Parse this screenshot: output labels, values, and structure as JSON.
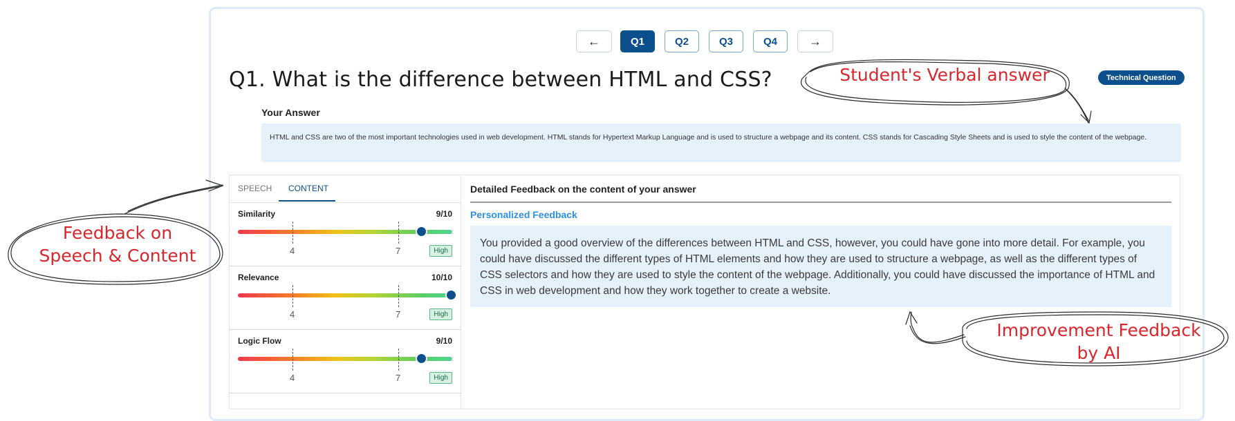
{
  "nav": {
    "prev_icon": "arrow-left-icon",
    "next_icon": "arrow-right-icon",
    "questions": [
      "Q1",
      "Q2",
      "Q3",
      "Q4"
    ],
    "active_question": "Q1"
  },
  "question": {
    "title": "Q1. What is the difference between HTML and CSS?",
    "tag": "Technical Question"
  },
  "answer": {
    "label": "Your Answer",
    "text": "HTML and CSS are two of the most important technologies used in web development. HTML stands for Hypertext Markup Language and is used to structure a webpage and its content. CSS stands for Cascading Style Sheets and is used to style the content of the webpage."
  },
  "tabs": {
    "speech": "SPEECH",
    "content": "CONTENT",
    "active": "CONTENT"
  },
  "metrics": [
    {
      "name": "Similarity",
      "score": "9/10",
      "value": 0.9,
      "tick_low": "4",
      "tick_high": "7",
      "badge": "High"
    },
    {
      "name": "Relevance",
      "score": "10/10",
      "value": 1.0,
      "tick_low": "4",
      "tick_high": "7",
      "badge": "High"
    },
    {
      "name": "Logic Flow",
      "score": "9/10",
      "value": 0.9,
      "tick_low": "4",
      "tick_high": "7",
      "badge": "High"
    }
  ],
  "feedback": {
    "title": "Detailed Feedback on the content of your answer",
    "subtitle": "Personalized Feedback",
    "text": "You provided a good overview of the differences between HTML and CSS, however, you could have gone into more detail. For example, you could have discussed the different types of HTML elements and how they are used to structure a webpage, as well as the different types of CSS selectors and how they are used to style the content of the webpage. Additionally, you could have discussed the importance of HTML and CSS in web development and how they work together to create a website."
  },
  "annotations": {
    "verbal": "Student's Verbal answer",
    "speech_line1": "Feedback on",
    "speech_line2": "Speech & Content",
    "ai_line1": "Improvement Feedback",
    "ai_line2": "by AI"
  },
  "colors": {
    "primary": "#0b4f8c",
    "answer_bg": "#e5f1fb",
    "annotation_red": "#d8262d",
    "subtitle_blue": "#2e8fe0"
  }
}
